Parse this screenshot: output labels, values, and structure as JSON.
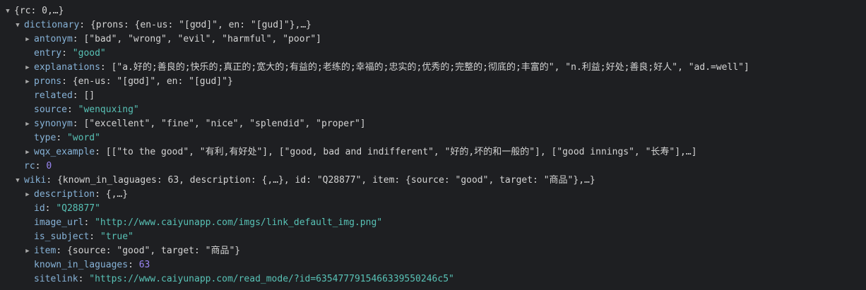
{
  "colors": {
    "background": "#1e1f22",
    "key": "#87b3d8",
    "string": "#58c2b6",
    "number": "#9b87f5",
    "text": "#d4d4d4"
  },
  "rows": [
    {
      "depth": 0,
      "toggle": "expanded",
      "name": "root",
      "key": "",
      "sep": "",
      "value": "{rc: 0,…}",
      "vtype": "plain"
    },
    {
      "depth": 1,
      "toggle": "expanded",
      "name": "dictionary",
      "key": "dictionary",
      "sep": ": ",
      "value": "{prons: {en-us: \"[gʊd]\", en: \"[gud]\"},…}",
      "vtype": "plain"
    },
    {
      "depth": 2,
      "toggle": "collapsed",
      "name": "antonym",
      "key": "antonym",
      "sep": ": ",
      "value": "[\"bad\", \"wrong\", \"evil\", \"harmful\", \"poor\"]",
      "vtype": "plain"
    },
    {
      "depth": 2,
      "toggle": "none",
      "name": "entry",
      "key": "entry",
      "sep": ": ",
      "value": "\"good\"",
      "vtype": "s"
    },
    {
      "depth": 2,
      "toggle": "collapsed",
      "name": "explanations",
      "key": "explanations",
      "sep": ": ",
      "value": "[\"a.好的;善良的;快乐的;真正的;宽大的;有益的;老练的;幸福的;忠实的;优秀的;完整的;彻底的;丰富的\", \"n.利益;好处;善良;好人\", \"ad.=well\"]",
      "vtype": "plain"
    },
    {
      "depth": 2,
      "toggle": "collapsed",
      "name": "prons",
      "key": "prons",
      "sep": ": ",
      "value": "{en-us: \"[gʊd]\", en: \"[gud]\"}",
      "vtype": "plain"
    },
    {
      "depth": 2,
      "toggle": "none",
      "name": "related",
      "key": "related",
      "sep": ": ",
      "value": "[]",
      "vtype": "plain"
    },
    {
      "depth": 2,
      "toggle": "none",
      "name": "source",
      "key": "source",
      "sep": ": ",
      "value": "\"wenquxing\"",
      "vtype": "s"
    },
    {
      "depth": 2,
      "toggle": "collapsed",
      "name": "synonym",
      "key": "synonym",
      "sep": ": ",
      "value": "[\"excellent\", \"fine\", \"nice\", \"splendid\", \"proper\"]",
      "vtype": "plain"
    },
    {
      "depth": 2,
      "toggle": "none",
      "name": "type",
      "key": "type",
      "sep": ": ",
      "value": "\"word\"",
      "vtype": "s"
    },
    {
      "depth": 2,
      "toggle": "collapsed",
      "name": "wqx-example",
      "key": "wqx_example",
      "sep": ": ",
      "value": "[[\"to the good\", \"有利,有好处\"], [\"good, bad and indifferent\", \"好的,坏的和一般的\"], [\"good innings\", \"长寿\"],…]",
      "vtype": "plain"
    },
    {
      "depth": 1,
      "toggle": "none",
      "name": "rc",
      "key": "rc",
      "sep": ": ",
      "value": "0",
      "vtype": "n"
    },
    {
      "depth": 1,
      "toggle": "expanded",
      "name": "wiki",
      "key": "wiki",
      "sep": ": ",
      "value": "{known_in_laguages: 63, description: {,…}, id: \"Q28877\", item: {source: \"good\", target: \"商品\"},…}",
      "vtype": "plain"
    },
    {
      "depth": 2,
      "toggle": "collapsed",
      "name": "description",
      "key": "description",
      "sep": ": ",
      "value": "{,…}",
      "vtype": "plain"
    },
    {
      "depth": 2,
      "toggle": "none",
      "name": "id",
      "key": "id",
      "sep": ": ",
      "value": "\"Q28877\"",
      "vtype": "s"
    },
    {
      "depth": 2,
      "toggle": "none",
      "name": "image-url",
      "key": "image_url",
      "sep": ": ",
      "value": "\"http://www.caiyunapp.com/imgs/link_default_img.png\"",
      "vtype": "s"
    },
    {
      "depth": 2,
      "toggle": "none",
      "name": "is-subject",
      "key": "is_subject",
      "sep": ": ",
      "value": "\"true\"",
      "vtype": "s"
    },
    {
      "depth": 2,
      "toggle": "collapsed",
      "name": "item",
      "key": "item",
      "sep": ": ",
      "value": "{source: \"good\", target: \"商品\"}",
      "vtype": "plain"
    },
    {
      "depth": 2,
      "toggle": "none",
      "name": "known-in-laguages",
      "key": "known_in_laguages",
      "sep": ": ",
      "value": "63",
      "vtype": "n"
    },
    {
      "depth": 2,
      "toggle": "none",
      "name": "sitelink",
      "key": "sitelink",
      "sep": ": ",
      "value": "\"https://www.caiyunapp.com/read_mode/?id=6354777915466339550246c5\"",
      "vtype": "s"
    }
  ]
}
